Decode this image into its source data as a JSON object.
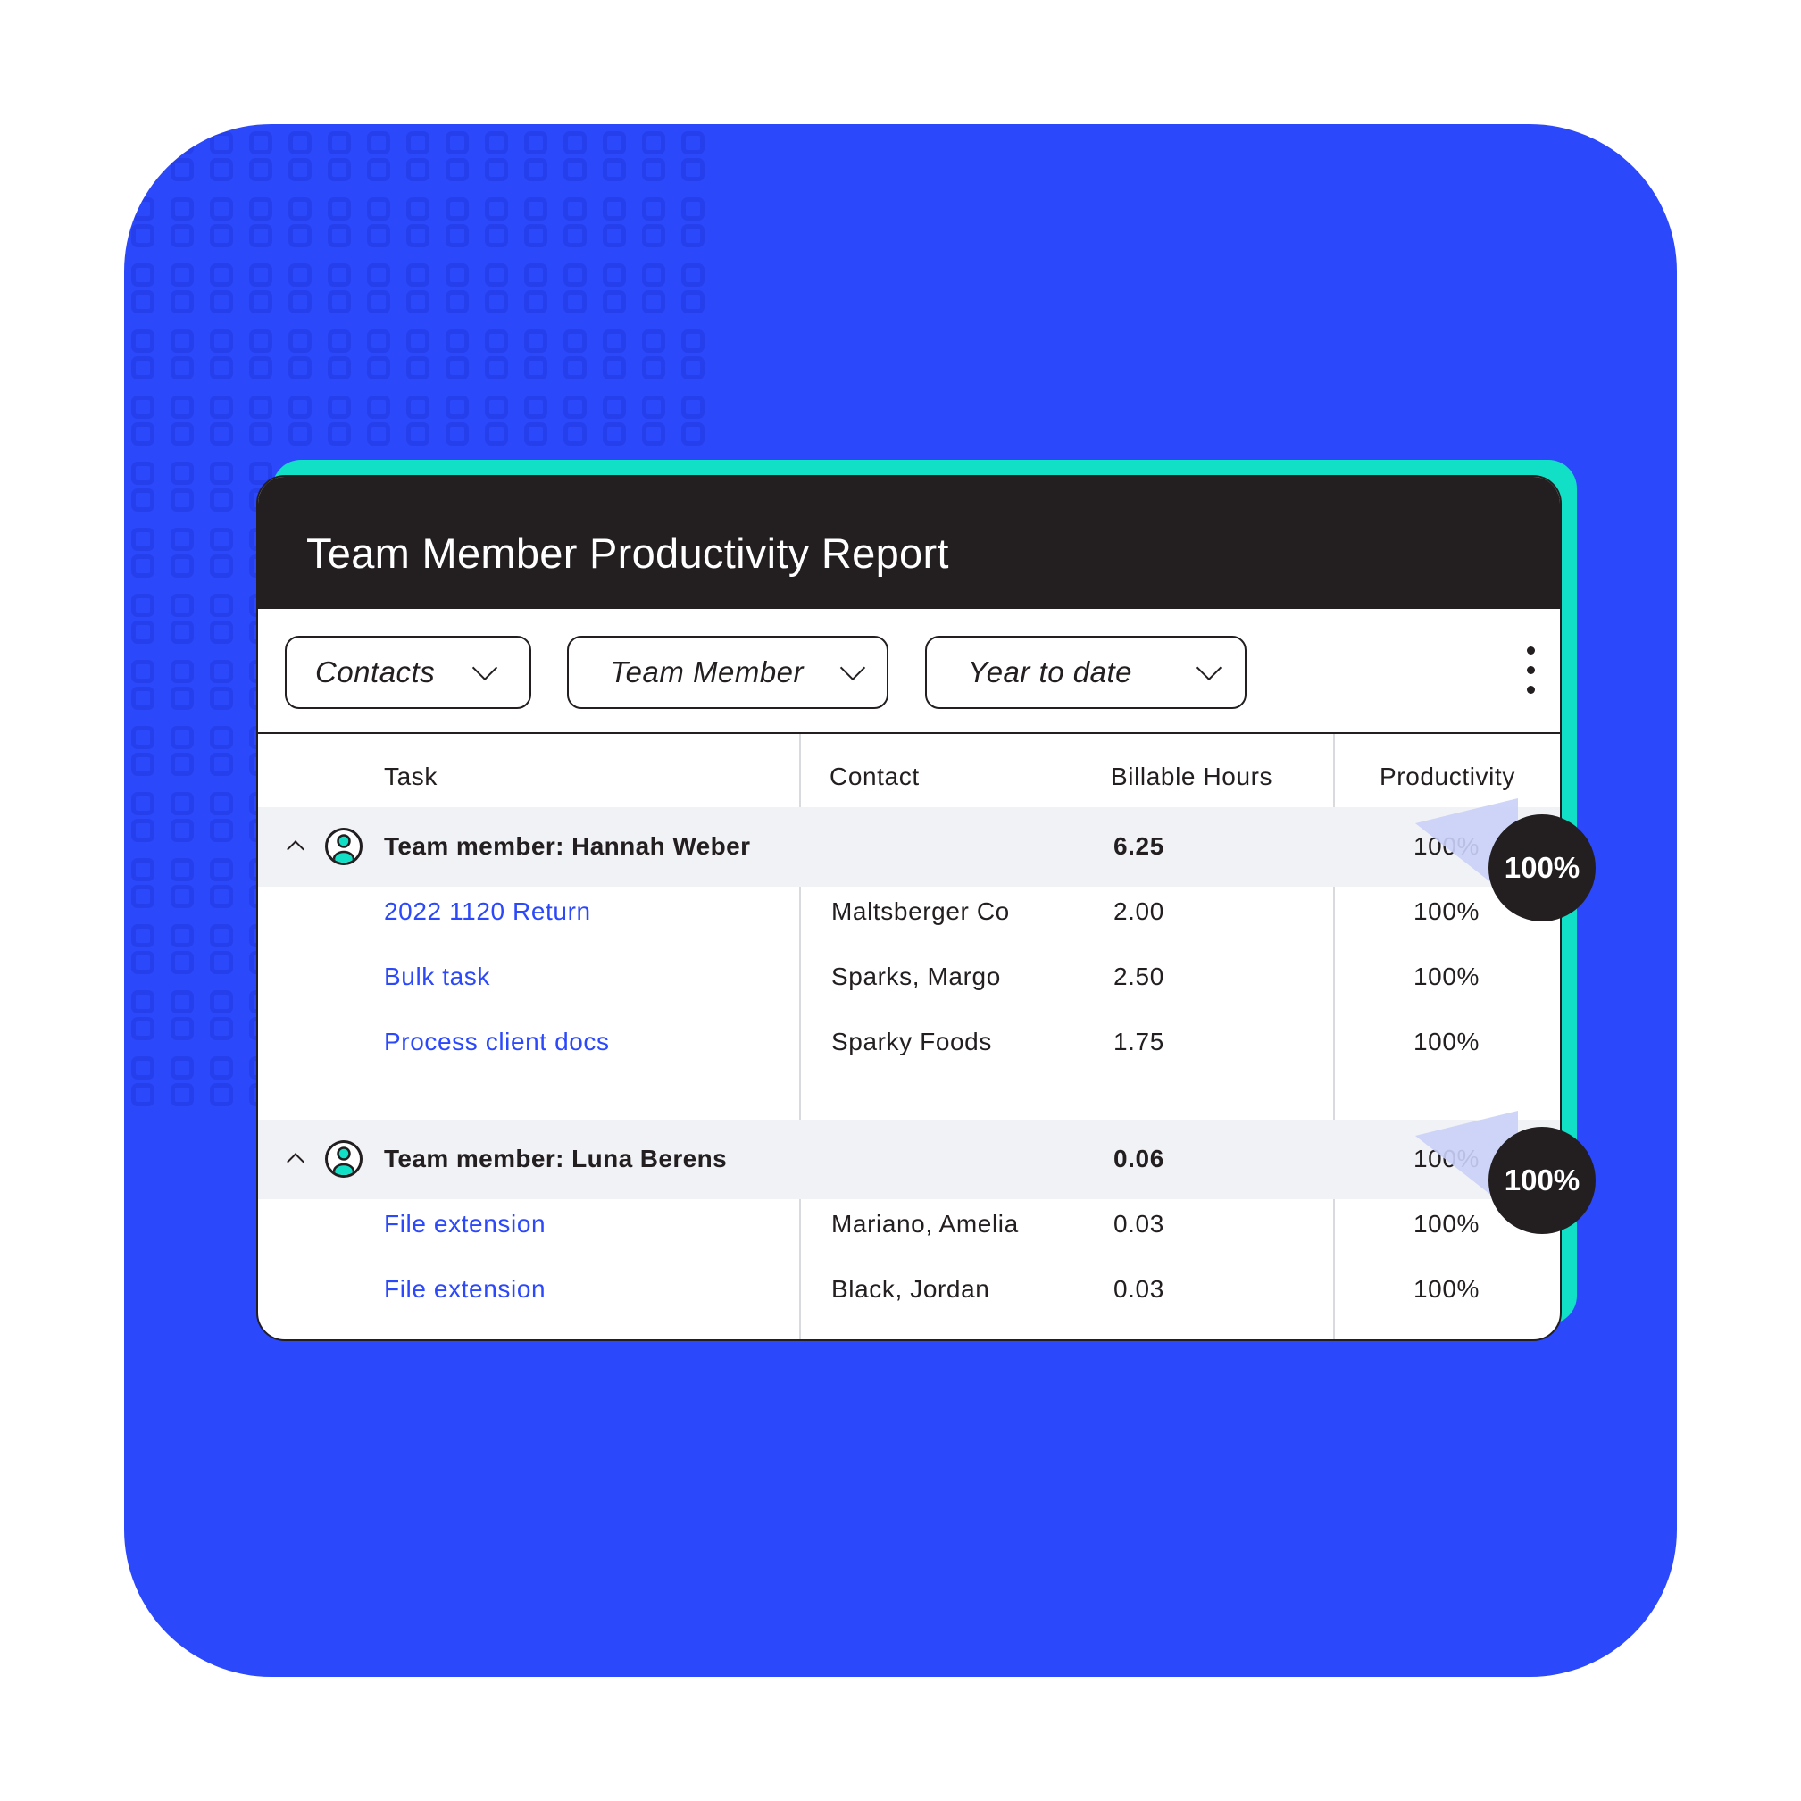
{
  "report": {
    "title": "Team Member Productivity Report"
  },
  "filters": [
    {
      "label": "Contacts",
      "icon": "chevron-down-icon"
    },
    {
      "label": "Team Member",
      "icon": "chevron-down-icon"
    },
    {
      "label": "Year to date",
      "icon": "chevron-down-icon"
    }
  ],
  "more_menu_icon": "kebab-icon",
  "table": {
    "columns": [
      "Task",
      "Contact",
      "Billable Hours",
      "Productivity"
    ],
    "groups": [
      {
        "label": "Team member: Hannah Weber",
        "billable_hours": "6.25",
        "productivity": "100%",
        "callout": "100%",
        "rows": [
          {
            "task": "2022 1120 Return",
            "contact": "Maltsberger Co",
            "billable_hours": "2.00",
            "productivity": "100%"
          },
          {
            "task": "Bulk task",
            "contact": "Sparks, Margo",
            "billable_hours": "2.50",
            "productivity": "100%"
          },
          {
            "task": "Process client docs",
            "contact": "Sparky Foods",
            "billable_hours": "1.75",
            "productivity": "100%"
          }
        ]
      },
      {
        "label": "Team member: Luna Berens",
        "billable_hours": "0.06",
        "productivity": "100%",
        "callout": "100%",
        "rows": [
          {
            "task": "File extension",
            "contact": "Mariano, Amelia",
            "billable_hours": "0.03",
            "productivity": "100%"
          },
          {
            "task": "File extension",
            "contact": "Black, Jordan",
            "billable_hours": "0.03",
            "productivity": "100%"
          }
        ]
      }
    ]
  },
  "colors": {
    "background_blue": "#2b48fb",
    "accent_teal": "#11e0c6",
    "header_dark": "#231f20",
    "link_blue": "#2b48fb",
    "group_row_bg": "#f1f2f6",
    "callout_beam": "#c9d0f7"
  }
}
